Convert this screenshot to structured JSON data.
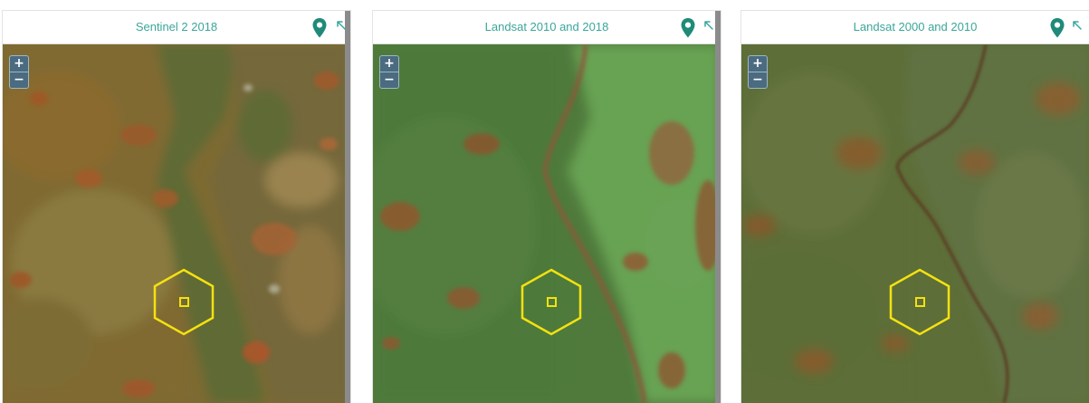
{
  "panels": [
    {
      "title": "Sentinel 2 2018",
      "zoom_in": "+",
      "zoom_out": "−",
      "pin_icon": "map-pin-icon",
      "expand_icon": "arrow-up-left-icon"
    },
    {
      "title": "Landsat 2010 and 2018",
      "zoom_in": "+",
      "zoom_out": "−",
      "pin_icon": "map-pin-icon",
      "expand_icon": "arrow-up-left-icon"
    },
    {
      "title": "Landsat 2000 and 2010",
      "zoom_in": "+",
      "zoom_out": "−",
      "pin_icon": "map-pin-icon",
      "expand_icon": "arrow-up-left-icon"
    }
  ],
  "colors": {
    "title_text": "#3aa69b",
    "marker_yellow": "#f5e10f",
    "pin_teal": "#1f8a7a"
  }
}
